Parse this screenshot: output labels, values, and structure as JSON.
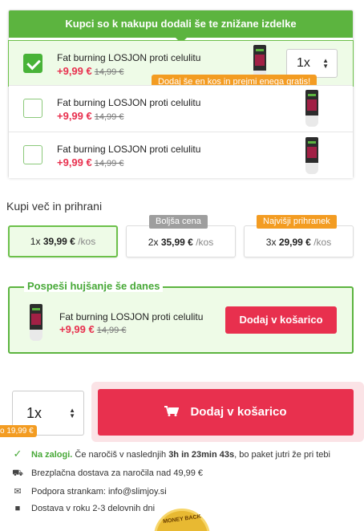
{
  "upsell": {
    "header": "Kupci so k nakupu dodali še te znižane izdelke",
    "gift_note": "Dodaj še en kos in prejmi enega gratis!",
    "items": [
      {
        "name": "Fat burning LOSJON proti celulitu",
        "price": "+9,99 €",
        "old_price": "14,99 €",
        "selected": true,
        "qty": "1x"
      },
      {
        "name": "Fat burning LOSJON proti celulitu",
        "price": "+9,99 €",
        "old_price": "14,99 €",
        "selected": false
      },
      {
        "name": "Fat burning LOSJON proti celulitu",
        "price": "+9,99 €",
        "old_price": "14,99 €",
        "selected": false
      }
    ]
  },
  "buy_more": {
    "title": "Kupi več in prihrani",
    "options": [
      {
        "qty": "1x",
        "price": "39,99 €",
        "unit": "/kos",
        "badge": ""
      },
      {
        "qty": "2x",
        "price": "35,99 €",
        "unit": "/kos",
        "badge": "Boljša cena"
      },
      {
        "qty": "3x",
        "price": "29,99 €",
        "unit": "/kos",
        "badge": "Najvišji prihranek"
      }
    ]
  },
  "speed": {
    "title": "Pospeši hujšanje še danes",
    "name": "Fat burning LOSJON proti celulitu",
    "price": "+9,99 €",
    "old_price": "14,99 €",
    "button": "Dodaj v košarico"
  },
  "purchase": {
    "qty": "1x",
    "button": "Dodaj v košarico",
    "tag": "o 19,99 €"
  },
  "info": {
    "stock_label": "Na zalogi.",
    "stock_text_a": " Če naročiš v naslednjih ",
    "countdown": "3h in 23min 43s",
    "stock_text_b": ", bo paket jutri že pri tebi",
    "shipping": "Brezplačna dostava za naročila nad 49,99 €",
    "support": "Podpora strankam: info@slimjoy.si",
    "delivery": "Dostava v roku 2-3 delovnih dni"
  },
  "seal": "MONEY BACK",
  "colors": {
    "green": "#5cb43f",
    "red": "#e8304e",
    "orange": "#f39c22"
  },
  "icons": [
    "check-icon",
    "chevron-updown-icon",
    "cart-icon",
    "truck-icon",
    "mail-icon",
    "box-icon"
  ]
}
